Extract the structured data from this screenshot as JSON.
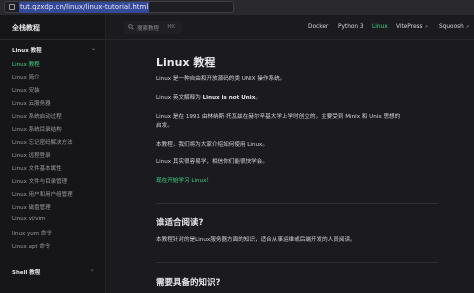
{
  "browser": {
    "url": "tut.qzxdp.cn/linux/linux-tutorial.html"
  },
  "sidebar": {
    "brand": "全栈教程",
    "sections": [
      {
        "title": "Linux 教程",
        "items": [
          "Linux 教程",
          "Linux 简介",
          "Linux 安装",
          "Linux 云服务器",
          "Linux 系统启动过程",
          "Linux 系统目录结构",
          "Linux 忘记密码解决方法",
          "Linux 远程登录",
          "Linux 文件基本属性",
          "Linux 文件与目录管理",
          "Linux 用户和用户组管理",
          "Linux 磁盘管理",
          "Linux vi/vim",
          "linux yum 命令",
          "Linux apt 命令"
        ]
      },
      {
        "title": "Shell 教程",
        "items": []
      }
    ],
    "active_item": "Linux 教程"
  },
  "topnav": {
    "search_placeholder": "搜索教程",
    "search_shortcut": "⌘K",
    "links": [
      "Docker",
      "Python 3",
      "Linux",
      "VitePress",
      "Squoosh"
    ],
    "external_mark": "↗",
    "active_link": "Linux"
  },
  "main": {
    "title": "Linux 教程",
    "paragraphs": {
      "p1": "Linux 是一种自由和开放源码的类 UNIX 操作系统。",
      "p2_prefix": "Linux 英文解释为 ",
      "p2_bold": "Linux is not Unix",
      "p2_suffix": "。",
      "p3_line1": "Linux 是在 1991 由林纳斯·托瓦兹在赫尔辛基大学上学时创立的，主要受到 Minix 和 Unix 思想的",
      "p3_line2": "启发。",
      "p4": "本教程，我们将为大家介绍如何使用 Linux。",
      "p5": "Linux 其实很容易学，相信你们能很快学会。"
    },
    "start_link": "现在开始学习 Linux！",
    "section1_title": "谁适合阅读?",
    "section1_text": "本教程针对的是Linux服务器方面的知识，适合从事运维或后端开发的人员阅读。",
    "section2_title": "需要具备的知识?"
  },
  "colors": {
    "accent": "#3dd68c",
    "background": "#1b1b1f",
    "sidebar": "#161618"
  }
}
